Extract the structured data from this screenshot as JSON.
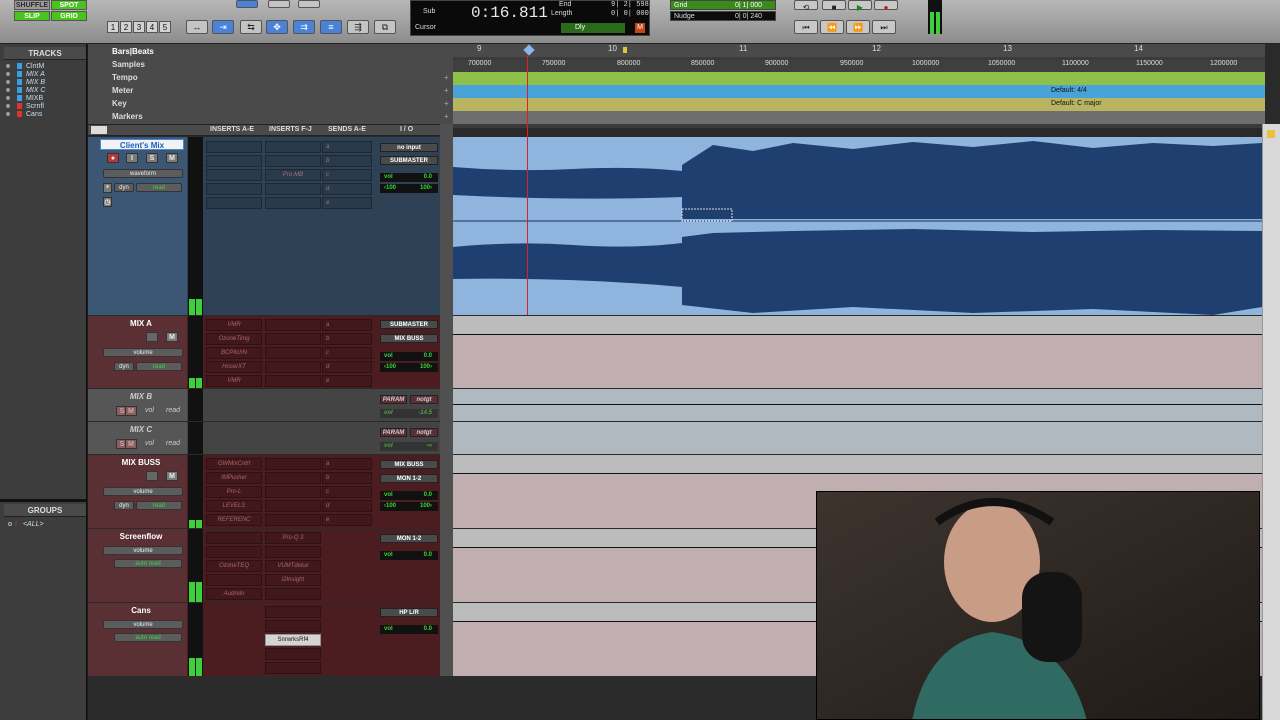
{
  "toolbar": {
    "modes": [
      "SHUFFLE",
      "SPOT",
      "SLIP",
      "GRID"
    ],
    "zoom_presets": [
      "1",
      "2",
      "3",
      "4",
      "5"
    ],
    "counter": {
      "main": "0:16.811",
      "sub_label": "Sub",
      "cursor_label": "Cursor",
      "end_label": "End",
      "length_label": "Length",
      "end_value": "9| 2| 598",
      "length_value": "0| 0| 000",
      "dly_label": "Dly"
    },
    "grid": {
      "label": "Grid",
      "value": "0| 1| 000"
    },
    "nudge": {
      "label": "Nudge",
      "value": "0| 0| 240"
    }
  },
  "left_panel": {
    "tracks_title": "TRACKS",
    "tracks": [
      "ClntM",
      "MIX A",
      "MIX B",
      "MIX C",
      "MIXB",
      "Scrnfl",
      "Cans"
    ],
    "groups_title": "GROUPS",
    "groups": [
      "<ALL>"
    ]
  },
  "rulers": {
    "main_label": "Bars|Beats",
    "rows": [
      "Samples",
      "Tempo",
      "Meter",
      "Key",
      "Markers"
    ],
    "bars": [
      "9",
      "10",
      "11",
      "12",
      "13",
      "14"
    ],
    "samples": [
      "700000",
      "750000",
      "800000",
      "850000",
      "900000",
      "950000",
      "1000000",
      "1050000",
      "1100000",
      "1150000",
      "1200000"
    ],
    "meter_default": "Default: 4/4",
    "key_default": "Default: C major"
  },
  "columns": [
    "INSERTS A-E",
    "INSERTS F-J",
    "SENDS A-E",
    "I / O"
  ],
  "tracks": [
    {
      "name": "Client's Mix",
      "view": "waveform",
      "auto": "read",
      "dyn": "dyn",
      "input": "no input",
      "output": "SUBMASTER",
      "vol_label": "vol",
      "vol": "0.0",
      "pan_l": "‹100",
      "pan_r": "100›",
      "inserts_a": [
        "",
        "",
        "",
        "",
        ""
      ],
      "inserts_f": [
        "",
        "",
        "Pro-MB",
        "",
        ""
      ],
      "sends": [
        "a",
        "b",
        "c",
        "d",
        "e"
      ]
    },
    {
      "name": "MIX A",
      "view": "volume",
      "auto": "read",
      "dyn": "dyn",
      "input": "SUBMASTER",
      "output": "MIX BUSS",
      "vol_label": "vol",
      "vol": "0.0",
      "pan_l": "‹100",
      "pan_r": "100›",
      "inserts_a": [
        "VMR",
        "OzoneTimg",
        "BCPitchN",
        "HoserXT",
        "VMR"
      ],
      "inserts_f": [
        "",
        "",
        "",
        "",
        ""
      ],
      "sends": [
        "a",
        "b",
        "c",
        "d",
        "e"
      ]
    },
    {
      "name": "MIX B",
      "view": "vol",
      "auto": "read",
      "input": "PARAM",
      "output": "notgt",
      "vol_label": "vol",
      "vol": "-14.5"
    },
    {
      "name": "MIX C",
      "view": "vol",
      "auto": "read",
      "input": "PARAM",
      "output": "notgt",
      "vol_label": "vol",
      "vol": "-∞"
    },
    {
      "name": "MIX BUSS",
      "view": "volume",
      "auto": "read",
      "dyn": "dyn",
      "input": "MIX BUSS",
      "output": "MON 1-2",
      "vol_label": "vol",
      "vol": "0.0",
      "pan_l": "‹100",
      "pan_r": "100›",
      "inserts_a": [
        "GWMixCntrl",
        "IMPusher",
        "Pro-L",
        "LEVELS",
        "REFERENC"
      ],
      "inserts_f": [
        "",
        "",
        "",
        "",
        ""
      ],
      "sends": [
        "a",
        "b",
        "c",
        "d",
        "e"
      ]
    },
    {
      "name": "Screenflow",
      "view": "volume",
      "auto": "auto read",
      "output": "MON 1-2",
      "vol_label": "vol",
      "vol": "0.0",
      "inserts_a": [
        "",
        "",
        "OzoneTEQ",
        "",
        "Audrelo"
      ],
      "inserts_f": [
        "Pro-Q 3",
        "",
        "VUMTdelux",
        "i2Insight",
        ""
      ]
    },
    {
      "name": "Cans",
      "view": "volume",
      "auto": "auto read",
      "output": "HP L/R",
      "vol_label": "vol",
      "vol": "0.0",
      "inserts_f": [
        "",
        "",
        "SnrwrksRf4",
        "",
        ""
      ]
    }
  ]
}
